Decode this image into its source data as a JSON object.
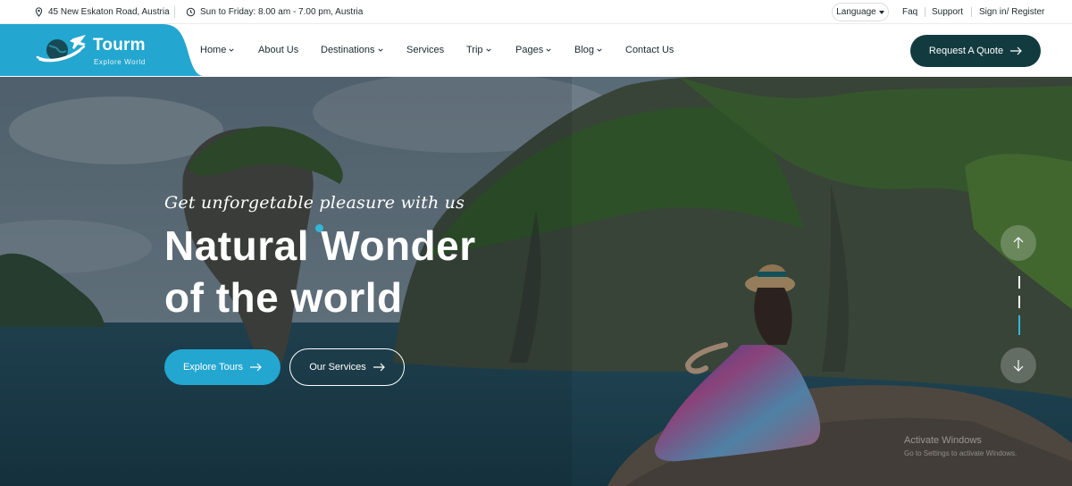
{
  "topbar": {
    "address": "45 New Eskaton Road, Austria",
    "hours": "Sun to Friday: 8.00 am - 7.00 pm, Austria",
    "language_label": "Language",
    "links": {
      "faq": "Faq",
      "support": "Support",
      "signin": "Sign in/ Register"
    }
  },
  "brand": {
    "name": "Tourm",
    "tagline": "Explore World",
    "color": "#23a6cf"
  },
  "nav": {
    "home": "Home",
    "about": "About Us",
    "destinations": "Destinations",
    "services": "Services",
    "trip": "Trip",
    "pages": "Pages",
    "blog": "Blog",
    "contact": "Contact Us"
  },
  "header_cta": {
    "label": "Request A Quote",
    "color": "#123b40"
  },
  "hero": {
    "kicker": "Get unforgetable pleasure with us",
    "title_line1": "Natural Wonder",
    "title_line2": "of the world",
    "primary_button": "Explore Tours",
    "secondary_button": "Our Services"
  },
  "watermark": {
    "title": "Activate Windows",
    "subtitle": "Go to Settings to activate Windows."
  },
  "icons": [
    "location-pin-icon",
    "clock-icon",
    "caret-down-icon",
    "chevron-down-icon",
    "arrow-right-icon",
    "arrow-up-icon",
    "arrow-down-icon",
    "plane-globe-logo"
  ]
}
